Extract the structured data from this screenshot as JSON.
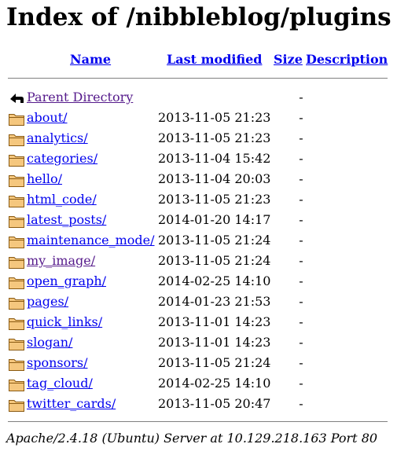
{
  "title": "Index of /nibbleblog/plugins",
  "columns": {
    "name": "Name",
    "last_modified": "Last modified",
    "size": "Size",
    "description": "Description"
  },
  "parent": {
    "label": "Parent Directory",
    "size": "-",
    "icon": "back-arrow-icon"
  },
  "entries": [
    {
      "name": "about/",
      "modified": "2013-11-05 21:23",
      "size": "-",
      "icon": "folder-icon"
    },
    {
      "name": "analytics/",
      "modified": "2013-11-05 21:23",
      "size": "-",
      "icon": "folder-icon"
    },
    {
      "name": "categories/",
      "modified": "2013-11-04 15:42",
      "size": "-",
      "icon": "folder-icon"
    },
    {
      "name": "hello/",
      "modified": "2013-11-04 20:03",
      "size": "-",
      "icon": "folder-icon"
    },
    {
      "name": "html_code/",
      "modified": "2013-11-05 21:23",
      "size": "-",
      "icon": "folder-icon"
    },
    {
      "name": "latest_posts/",
      "modified": "2014-01-20 14:17",
      "size": "-",
      "icon": "folder-icon"
    },
    {
      "name": "maintenance_mode/",
      "modified": "2013-11-05 21:24",
      "size": "-",
      "icon": "folder-icon"
    },
    {
      "name": "my_image/",
      "modified": "2013-11-05 21:24",
      "size": "-",
      "icon": "folder-icon",
      "visited": true
    },
    {
      "name": "open_graph/",
      "modified": "2014-02-25 14:10",
      "size": "-",
      "icon": "folder-icon"
    },
    {
      "name": "pages/",
      "modified": "2014-01-23 21:53",
      "size": "-",
      "icon": "folder-icon"
    },
    {
      "name": "quick_links/",
      "modified": "2013-11-01 14:23",
      "size": "-",
      "icon": "folder-icon"
    },
    {
      "name": "slogan/",
      "modified": "2013-11-01 14:23",
      "size": "-",
      "icon": "folder-icon"
    },
    {
      "name": "sponsors/",
      "modified": "2013-11-05 21:24",
      "size": "-",
      "icon": "folder-icon"
    },
    {
      "name": "tag_cloud/",
      "modified": "2014-02-25 14:10",
      "size": "-",
      "icon": "folder-icon"
    },
    {
      "name": "twitter_cards/",
      "modified": "2013-11-05 20:47",
      "size": "-",
      "icon": "folder-icon"
    }
  ],
  "footer": "Apache/2.4.18 (Ubuntu) Server at 10.129.218.163 Port 80",
  "colors": {
    "link": "#0000ee",
    "visited": "#551a8b",
    "folder_fill": "#f5c77e",
    "folder_stroke": "#8a5a12"
  }
}
